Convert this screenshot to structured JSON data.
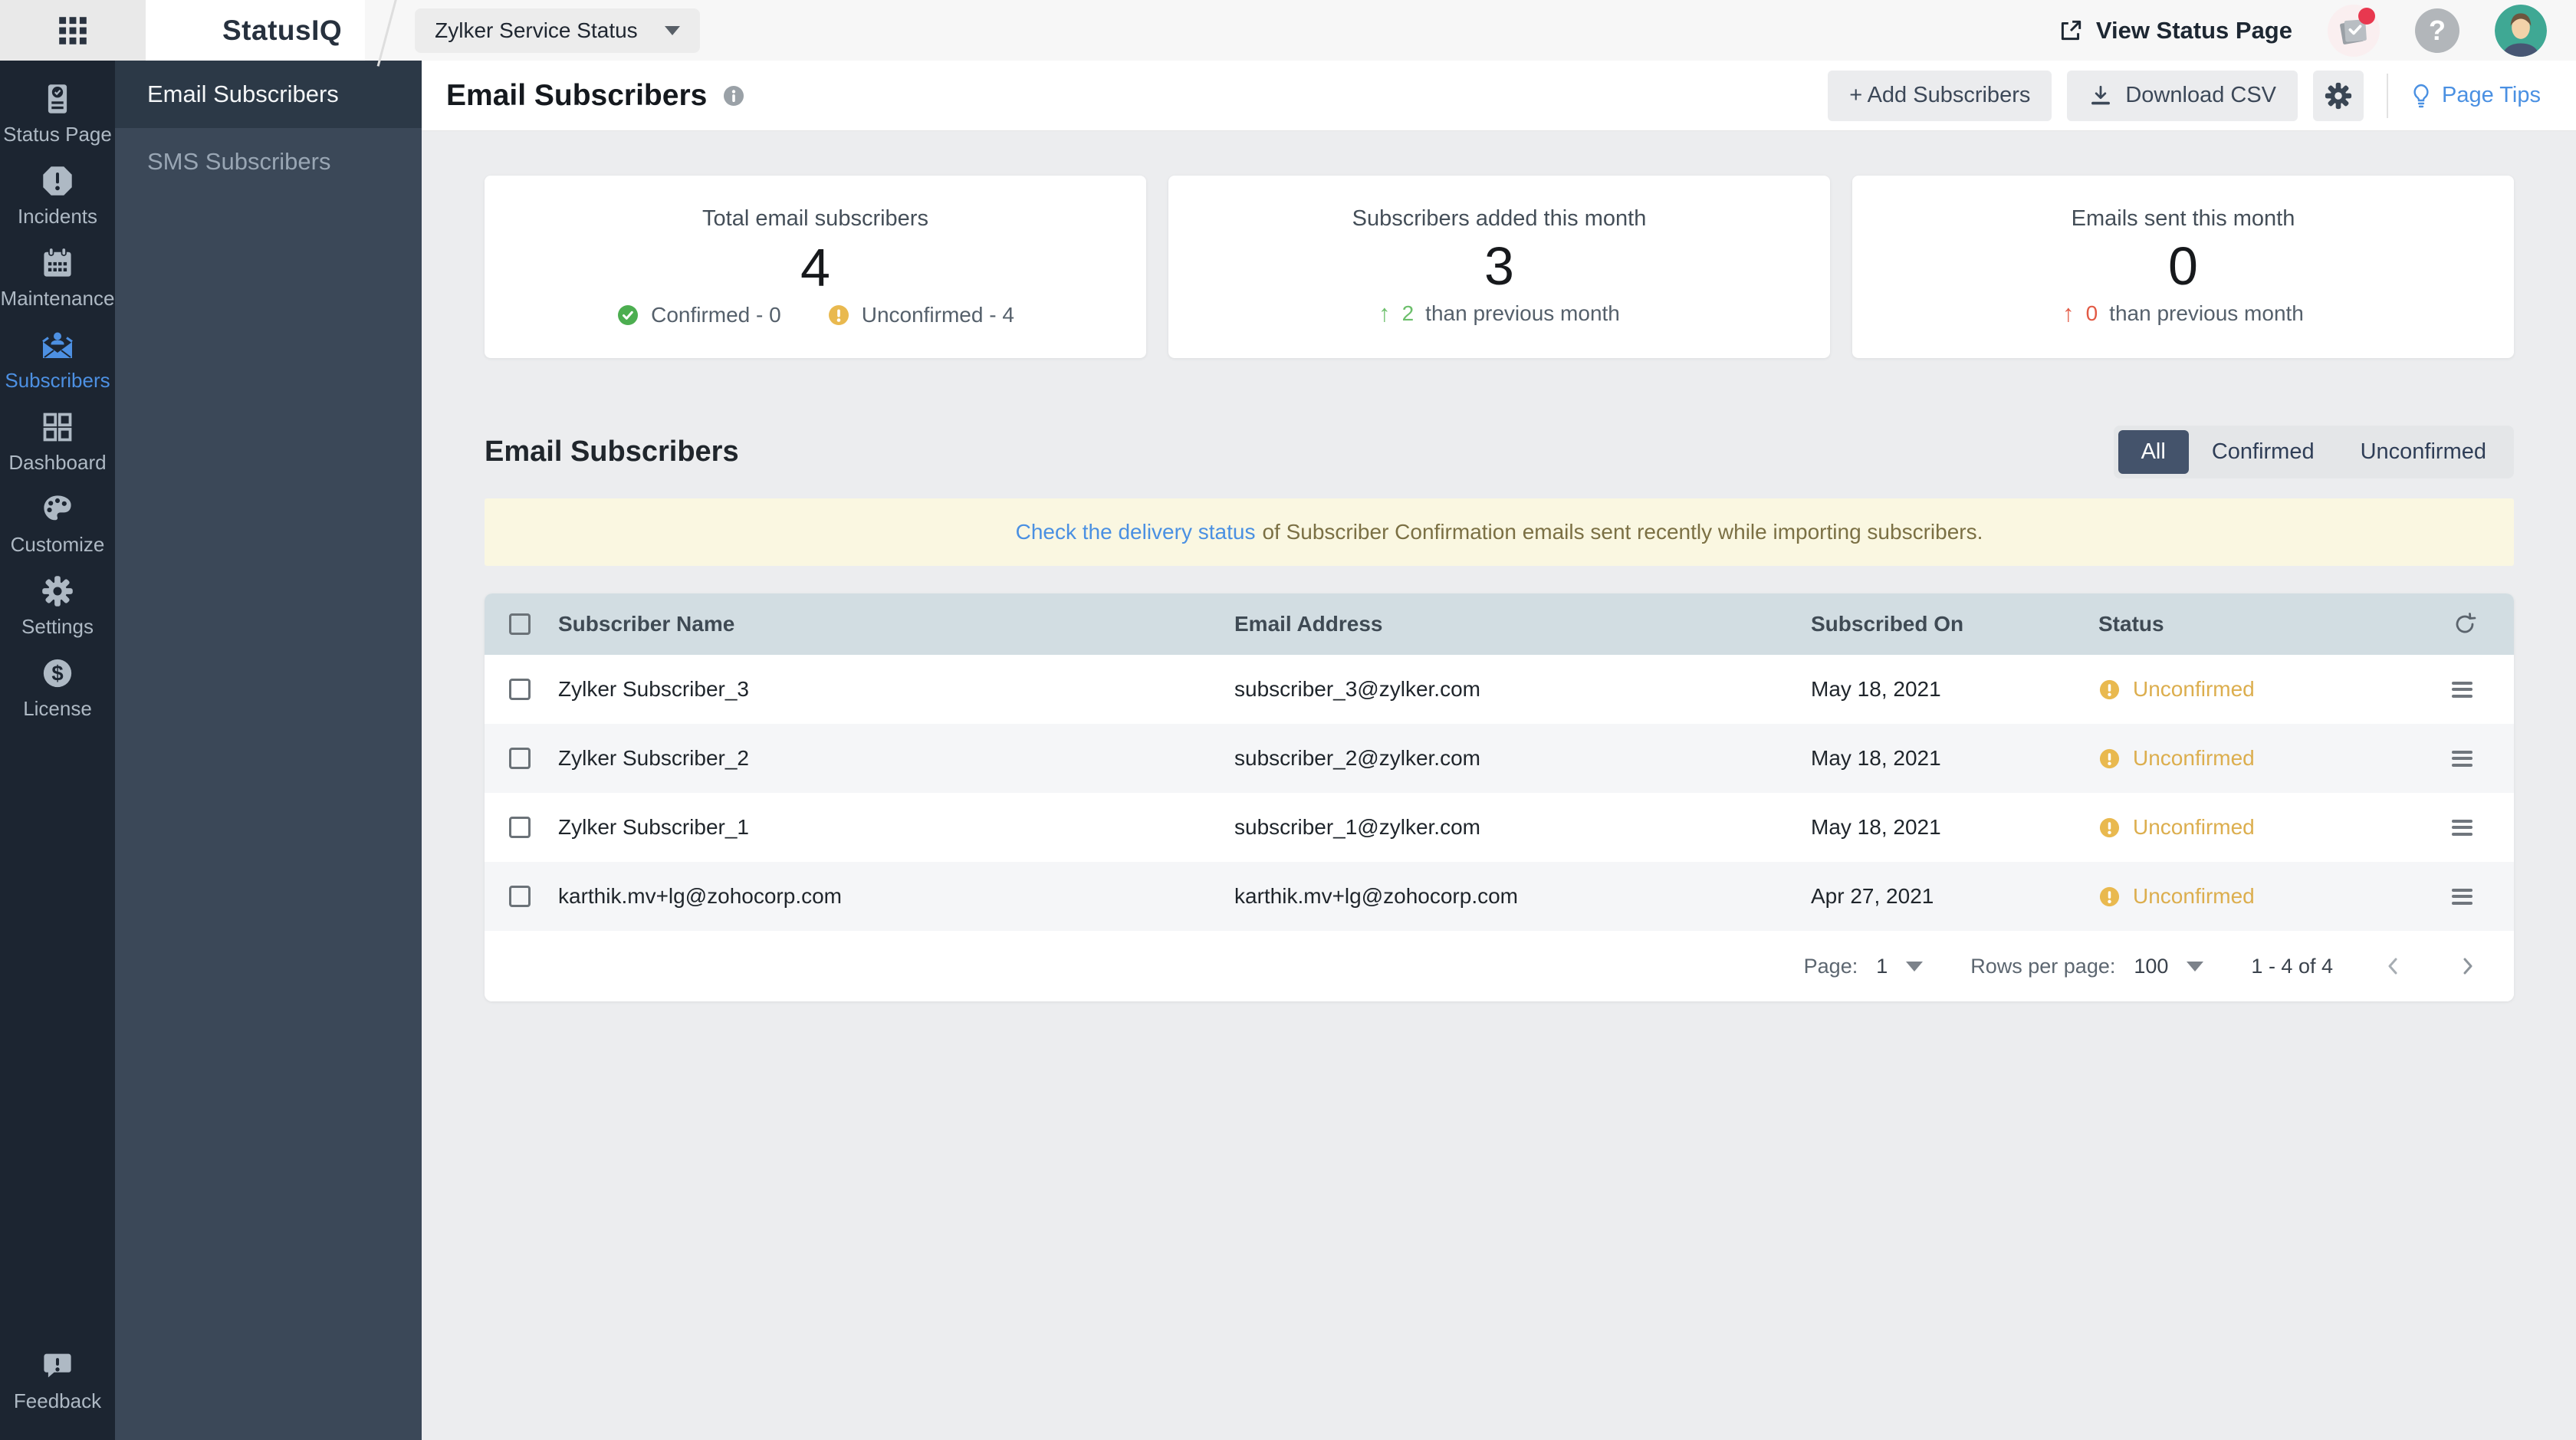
{
  "colors": {
    "accent_blue": "#4a90e2",
    "sidebar_bg": "#1c2531",
    "panel_bg": "#3b4858",
    "warning_yellow": "#e2b14e",
    "success_green": "#4cae50",
    "danger_red": "#e25a45",
    "table_header_bg": "#d2dde2",
    "notice_bg": "#faf7e1"
  },
  "topbar": {
    "brand": "StatusIQ",
    "status_page_selector": "Zylker Service Status",
    "view_status_page": "View Status Page"
  },
  "sidebar": {
    "items": [
      {
        "label": "Status Page",
        "icon": "status-page-icon",
        "active": false
      },
      {
        "label": "Incidents",
        "icon": "incidents-icon",
        "active": false
      },
      {
        "label": "Maintenance",
        "icon": "maintenance-icon",
        "active": false
      },
      {
        "label": "Subscribers",
        "icon": "subscribers-icon",
        "active": true
      },
      {
        "label": "Dashboard",
        "icon": "dashboard-icon",
        "active": false
      },
      {
        "label": "Customize",
        "icon": "customize-icon",
        "active": false
      },
      {
        "label": "Settings",
        "icon": "settings-icon",
        "active": false
      },
      {
        "label": "License",
        "icon": "license-icon",
        "active": false
      }
    ],
    "feedback": {
      "label": "Feedback",
      "icon": "feedback-icon"
    }
  },
  "subnav": {
    "items": [
      {
        "label": "Email Subscribers",
        "active": true
      },
      {
        "label": "SMS Subscribers",
        "active": false
      }
    ]
  },
  "page": {
    "title": "Email Subscribers",
    "actions": {
      "add": "+ Add Subscribers",
      "download": "Download CSV",
      "page_tips": "Page Tips"
    }
  },
  "cards": [
    {
      "title": "Total email subscribers",
      "value": "4",
      "confirmed": "Confirmed - 0",
      "unconfirmed": "Unconfirmed - 4"
    },
    {
      "title": "Subscribers added this month",
      "value": "3",
      "delta": "2",
      "suffix": "than previous month",
      "trend": "up-green"
    },
    {
      "title": "Emails sent this month",
      "value": "0",
      "delta": "0",
      "suffix": "than previous month",
      "trend": "up-red"
    }
  ],
  "section": {
    "title": "Email Subscribers",
    "filters": [
      "All",
      "Confirmed",
      "Unconfirmed"
    ],
    "active_filter": "All"
  },
  "notice": {
    "link_text": "Check the delivery status",
    "rest_text": "of Subscriber Confirmation emails sent recently while importing subscribers."
  },
  "table": {
    "columns": [
      "Subscriber Name",
      "Email Address",
      "Subscribed On",
      "Status"
    ],
    "rows": [
      {
        "name": "Zylker Subscriber_3",
        "email": "subscriber_3@zylker.com",
        "date": "May 18, 2021",
        "status": "Unconfirmed"
      },
      {
        "name": "Zylker Subscriber_2",
        "email": "subscriber_2@zylker.com",
        "date": "May 18, 2021",
        "status": "Unconfirmed"
      },
      {
        "name": "Zylker Subscriber_1",
        "email": "subscriber_1@zylker.com",
        "date": "May 18, 2021",
        "status": "Unconfirmed"
      },
      {
        "name": "karthik.mv+lg@zohocorp.com",
        "email": "karthik.mv+lg@zohocorp.com",
        "date": "Apr 27, 2021",
        "status": "Unconfirmed"
      }
    ]
  },
  "pagination": {
    "page_label": "Page:",
    "page_value": "1",
    "rows_label": "Rows per page:",
    "rows_value": "100",
    "range": "1 - 4 of 4"
  }
}
